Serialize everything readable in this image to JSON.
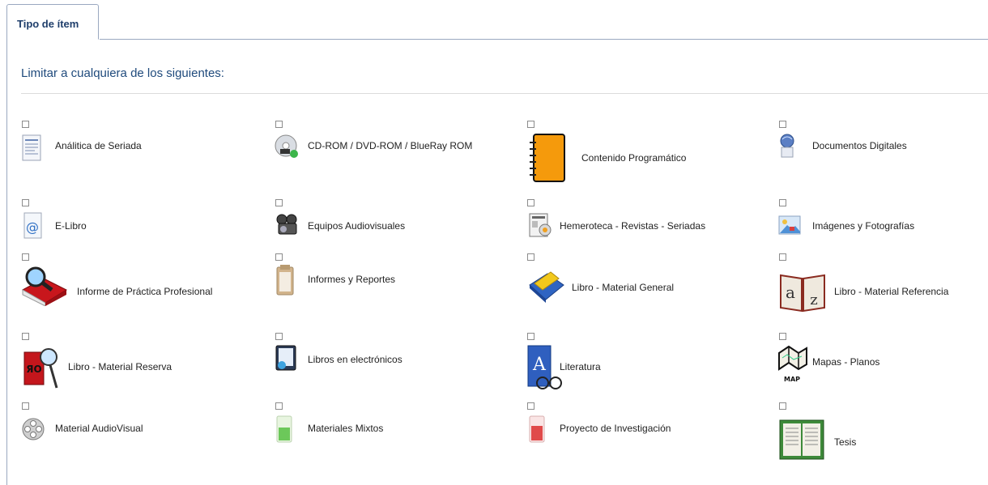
{
  "tab": {
    "label": "Tipo de ítem"
  },
  "heading": "Limitar a cualquiera de los siguientes:",
  "items": [
    {
      "label": "Análitica de Seriada",
      "icon": "document-icon"
    },
    {
      "label": "CD-ROM / DVD-ROM / BlueRay ROM",
      "icon": "cd-rom-icon"
    },
    {
      "label": "Contenido Programático",
      "icon": "notebook-icon"
    },
    {
      "label": "Documentos Digitales",
      "icon": "globe-document-icon"
    },
    {
      "label": "E-Libro",
      "icon": "email-page-icon"
    },
    {
      "label": "Equipos Audiovisuales",
      "icon": "video-camera-icon"
    },
    {
      "label": "Hemeroteca - Revistas - Seriadas",
      "icon": "newspaper-icon"
    },
    {
      "label": "Imágenes y Fotografías",
      "icon": "picture-icon"
    },
    {
      "label": "Informe de Práctica Profesional",
      "icon": "magnifier-book-icon"
    },
    {
      "label": "Informes y Reportes",
      "icon": "clipboard-icon"
    },
    {
      "label": "Libro - Material General",
      "icon": "blue-book-icon"
    },
    {
      "label": "Libro - Material Referencia",
      "icon": "az-dictionary-icon"
    },
    {
      "label": "Libro - Material Reserva",
      "icon": "red-book-magnifier-icon"
    },
    {
      "label": "Libros en electrónicos",
      "icon": "ebook-icon"
    },
    {
      "label": "Literatura",
      "icon": "book-glasses-icon"
    },
    {
      "label": "Mapas - Planos",
      "icon": "map-icon"
    },
    {
      "label": "Material AudioVisual",
      "icon": "film-reel-icon"
    },
    {
      "label": "Materiales Mixtos",
      "icon": "green-sheet-icon"
    },
    {
      "label": "Proyecto de Investigación",
      "icon": "red-sheet-icon"
    },
    {
      "label": "Tesis",
      "icon": "open-book-icon"
    }
  ]
}
